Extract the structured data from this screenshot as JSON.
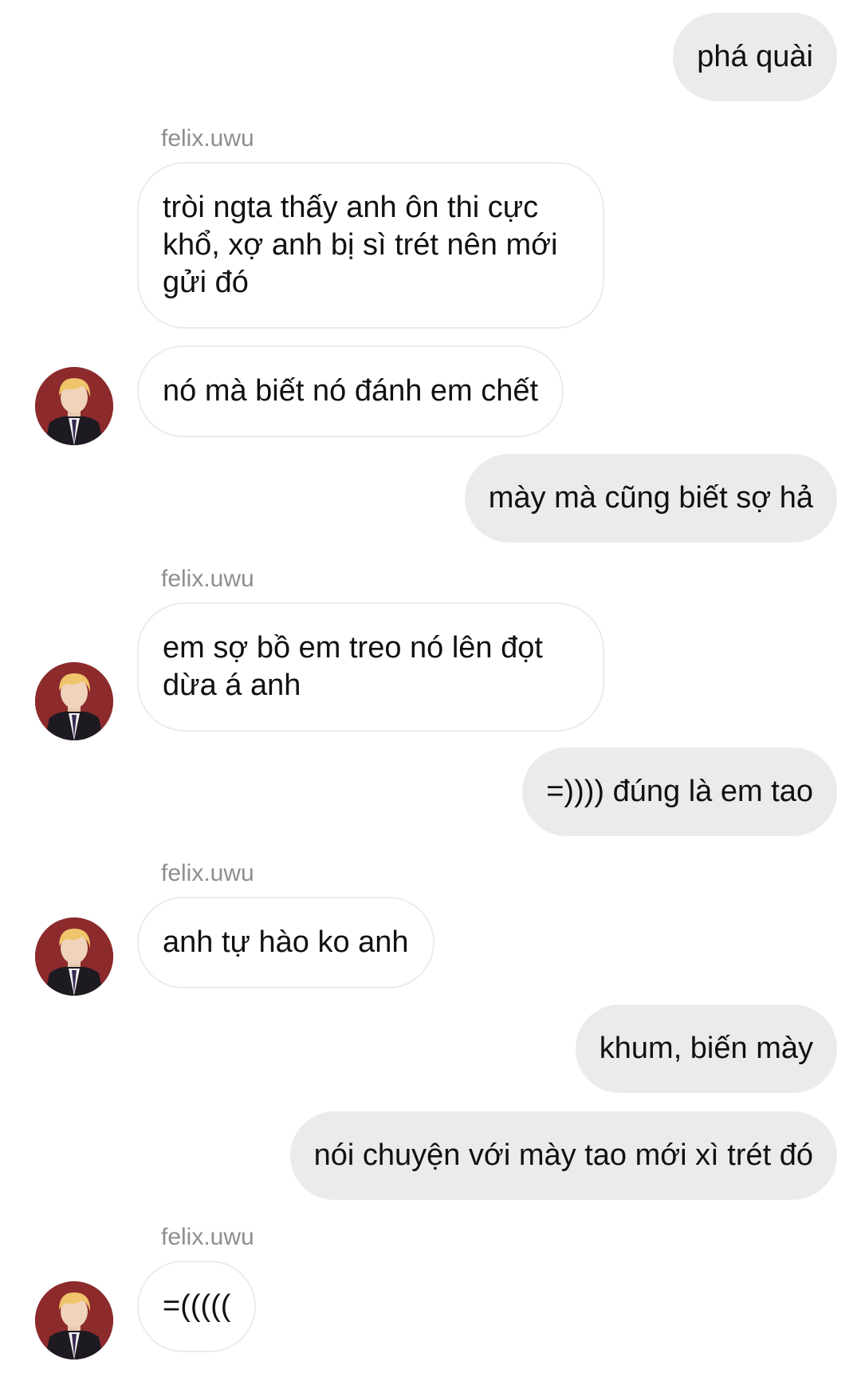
{
  "conversation": {
    "sender_name": "felix.uwu",
    "messages": [
      {
        "direction": "outgoing",
        "text": "phá quài"
      },
      {
        "direction": "incoming",
        "text": "tròi ngta thấy anh ôn thi cực khổ, xợ anh bị sì trét nên mới gửi đó"
      },
      {
        "direction": "incoming",
        "text": "nó mà biết nó đánh em chết"
      },
      {
        "direction": "outgoing",
        "text": "mày mà cũng biết sợ hả"
      },
      {
        "direction": "incoming",
        "text": "em sợ bồ em treo nó lên đọt dừa á anh"
      },
      {
        "direction": "outgoing",
        "text": "=)))) đúng là em tao"
      },
      {
        "direction": "incoming",
        "text": "anh tự hào ko anh"
      },
      {
        "direction": "outgoing",
        "text": "khum, biến mày"
      },
      {
        "direction": "outgoing",
        "text": "nói chuyện với mày tao mới xì trét đó"
      },
      {
        "direction": "incoming",
        "text": "=((((("
      }
    ]
  },
  "colors": {
    "outgoing_bubble": "#ebebeb",
    "incoming_border": "#ebebeb",
    "sender_label": "#8e8e8e"
  },
  "icons": {
    "avatar": "profile-photo-avatar"
  }
}
